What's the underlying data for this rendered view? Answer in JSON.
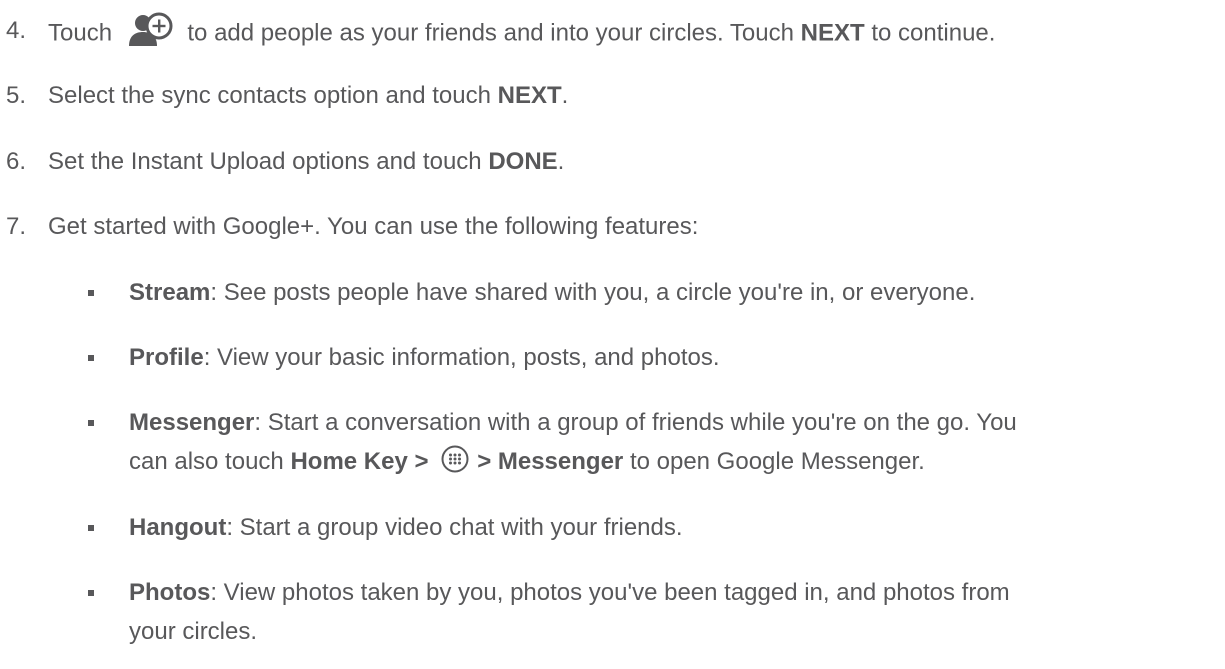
{
  "steps": [
    {
      "number": "4.",
      "pre": "Touch",
      "icon": "add-person-icon",
      "mid": "to add people as your friends and into your circles. Touch",
      "bold": "NEXT",
      "post": "to continue."
    },
    {
      "number": "5.",
      "pre": "Select the sync contacts option and touch",
      "bold": "NEXT",
      "post": "."
    },
    {
      "number": "6.",
      "pre": "Set the Instant Upload options and touch",
      "bold": "DONE",
      "post": "."
    },
    {
      "number": "7.",
      "text": "Get started with Google+. You can use the following features:"
    }
  ],
  "features": [
    {
      "term": "Stream",
      "desc": ": See posts people have shared with you, a circle you're in, or everyone."
    },
    {
      "term": "Profile",
      "desc": ": View your basic information, posts, and photos."
    },
    {
      "term": "Messenger",
      "desc": ": Start a conversation with a group of friends while you're on the go. You",
      "cont_pre": "can also touch",
      "cont_bold1": "Home Key >",
      "cont_icon": "apps-icon",
      "cont_bold2": "> Messenger",
      "cont_post": "to open Google Messenger."
    },
    {
      "term": "Hangout",
      "desc": ": Start a group video chat with your friends."
    },
    {
      "term": "Photos",
      "desc": ": View photos taken by you, photos you've been tagged in, and photos from",
      "cont": "your circles."
    }
  ],
  "colors": {
    "text": "#58585a",
    "icon": "#58585a"
  }
}
